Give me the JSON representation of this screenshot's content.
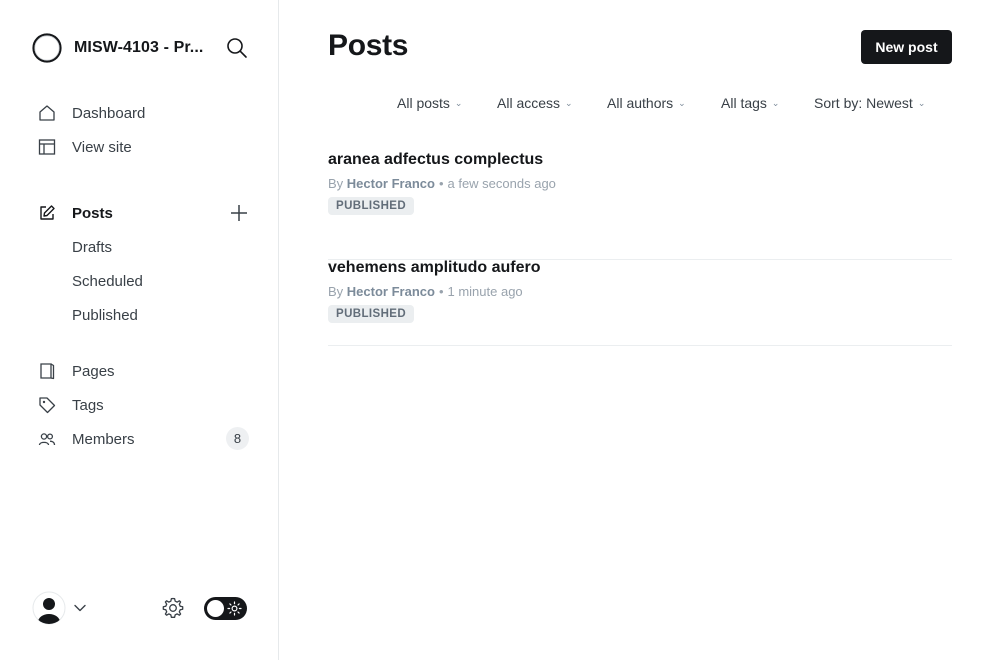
{
  "site": {
    "title": "MISW-4103 - Pr..."
  },
  "sidebar": {
    "items": [
      {
        "label": "Dashboard",
        "icon": "house-icon"
      },
      {
        "label": "View site",
        "icon": "layout-icon"
      },
      {
        "label": "Posts",
        "icon": "edit-icon"
      },
      {
        "label": "Pages",
        "icon": "page-icon"
      },
      {
        "label": "Tags",
        "icon": "tag-icon"
      },
      {
        "label": "Members",
        "icon": "members-icon",
        "count": "8"
      }
    ],
    "posts_sub": [
      "Drafts",
      "Scheduled",
      "Published"
    ]
  },
  "header": {
    "title": "Posts",
    "new_post_label": "New post"
  },
  "filters": [
    "All posts",
    "All access",
    "All authors",
    "All tags",
    "Sort by: Newest"
  ],
  "posts": [
    {
      "title": "aranea adfectus complectus",
      "by": "By",
      "author": "Hector Franco",
      "time": "a few seconds ago",
      "status": "PUBLISHED"
    },
    {
      "title": "vehemens amplitudo aufero",
      "by": "By",
      "author": "Hector Franco",
      "time": "1 minute ago",
      "status": "PUBLISHED"
    }
  ],
  "colors": {
    "accent": "#15171a",
    "badge_bg": "#ebeef0",
    "muted": "#99a3ad"
  }
}
